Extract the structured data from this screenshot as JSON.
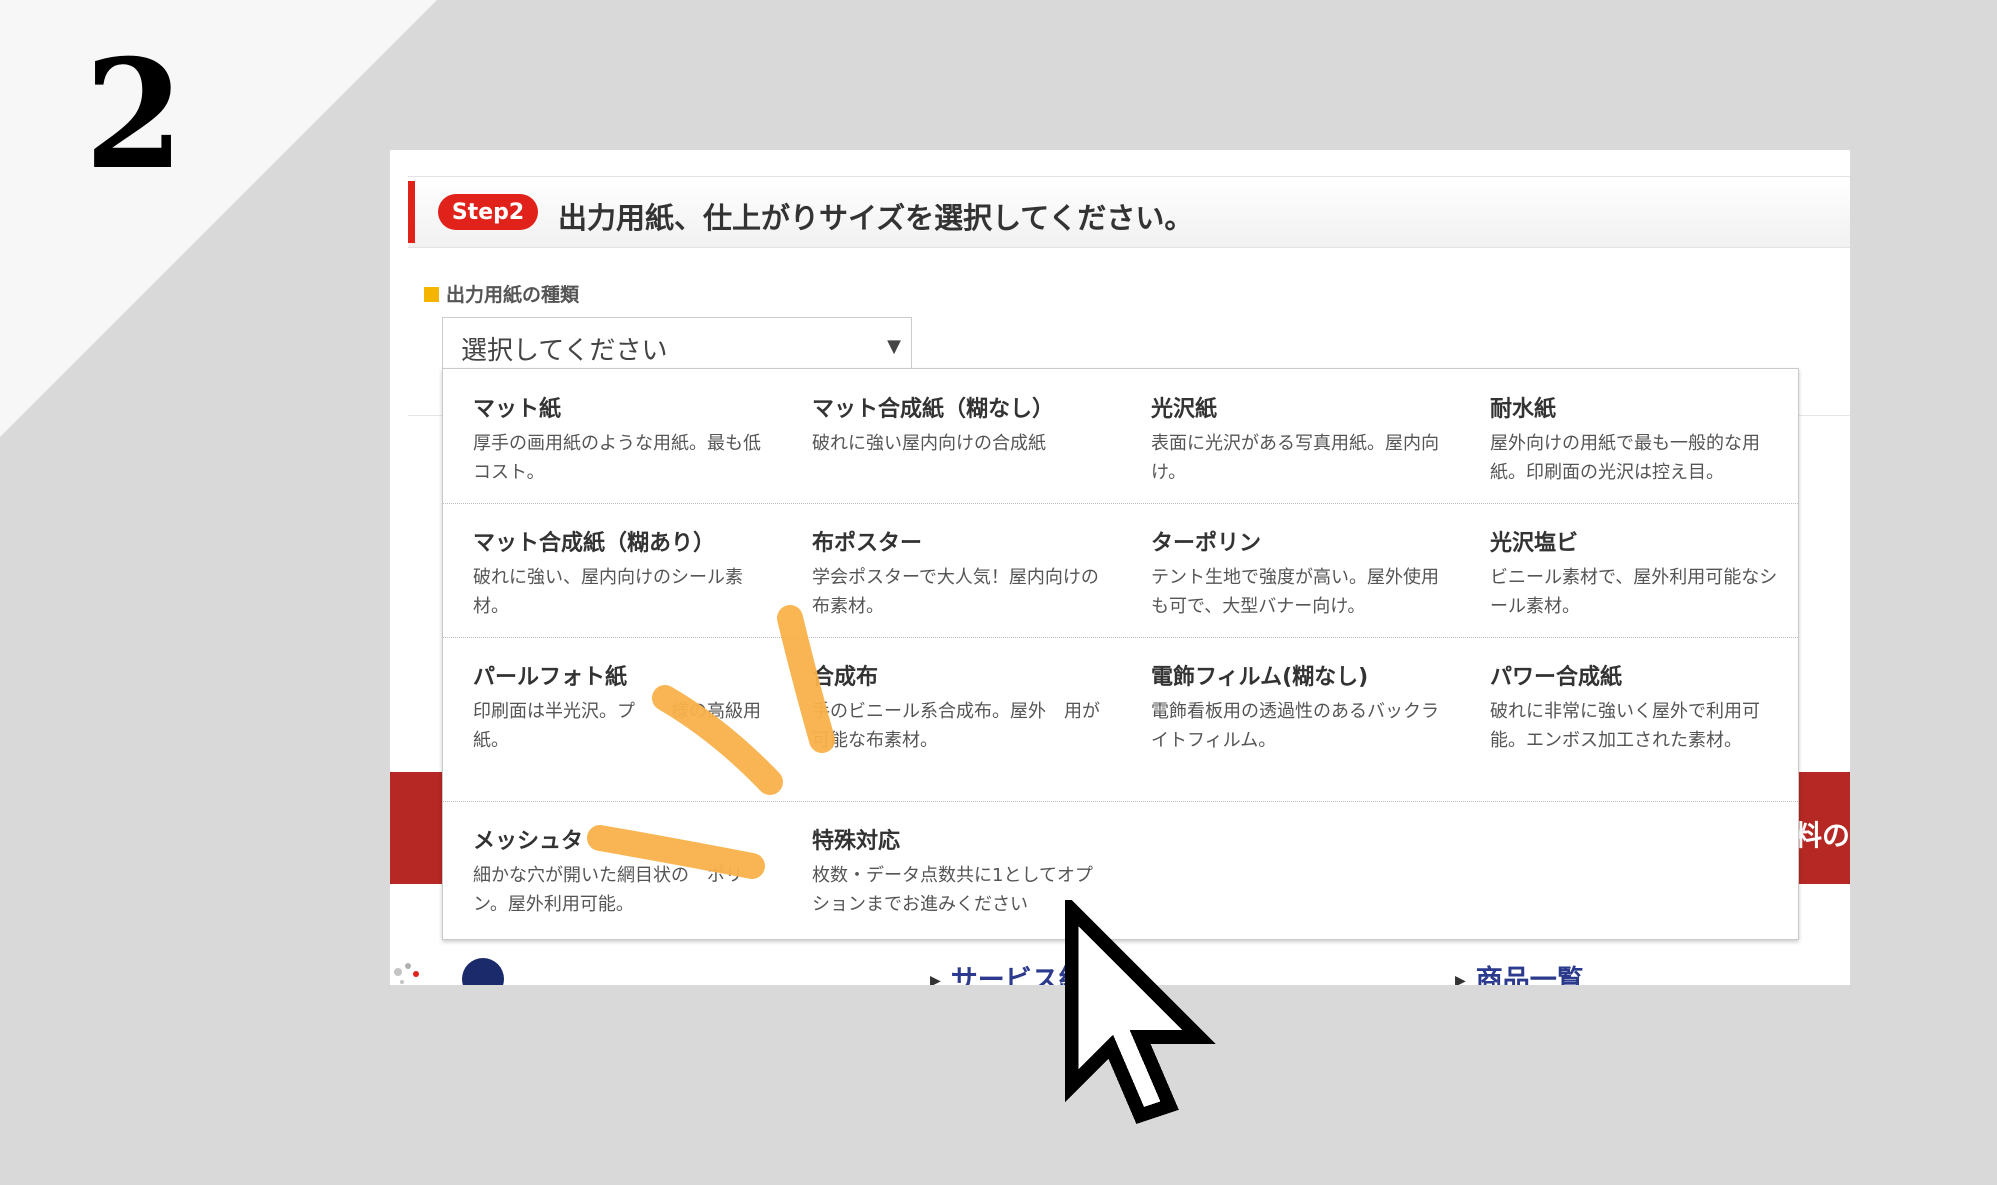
{
  "step_number": "2",
  "header": {
    "badge": "Step2",
    "title": "出力用紙、仕上がりサイズを選択してください。"
  },
  "paper_type": {
    "label": "出力用紙の種類",
    "select_value": "選択してください"
  },
  "options": [
    {
      "title": "マット紙",
      "desc": "厚手の画用紙のような用紙。最も低コスト。"
    },
    {
      "title": "マット合成紙（糊なし）",
      "desc": "破れに強い屋内向けの合成紙"
    },
    {
      "title": "光沢紙",
      "desc": "表面に光沢がある写真用紙。屋内向け。"
    },
    {
      "title": "耐水紙",
      "desc": "屋外向けの用紙で最も一般的な用紙。印刷面の光沢は控え目。"
    },
    {
      "title": "マット合成紙（糊あり）",
      "desc": "破れに強い、屋内向けのシール素材。"
    },
    {
      "title": "布ポスター",
      "desc": "学会ポスターで大人気！屋内向けの布素材。"
    },
    {
      "title": "ターポリン",
      "desc": "テント生地で強度が高い。屋外使用も可で、大型バナー向け。"
    },
    {
      "title": "光沢塩ビ",
      "desc": "ビニール素材で、屋外利用可能なシール素材。"
    },
    {
      "title": "パールフォト紙",
      "desc": "印刷面は半光沢。プ　　様の高級用紙。"
    },
    {
      "title": "合成布",
      "desc": "手のビニール系合成布。屋外　用が可能な布素材。"
    },
    {
      "title": "電飾フィルム(糊なし)",
      "desc": "電飾看板用の透過性のあるバックライトフィルム。"
    },
    {
      "title": "パワー合成紙",
      "desc": "破れに非常に強いく屋外で利用可能。エンボス加工された素材。"
    },
    {
      "title": "メッシュタ",
      "desc": "細かな穴が開いた網目状の　ポリン。屋外利用可能。"
    },
    {
      "title": "特殊対応",
      "desc": "枚数・データ点数共に1としてオプションまでお進みください"
    }
  ],
  "footer": {
    "link_service": "サービス紹",
    "link_products": "商品一覧",
    "band_text": "料の"
  },
  "colors": {
    "accent_red": "#e0221b",
    "band_red": "#b52824",
    "label_yellow": "#f5b400",
    "highlight_orange": "#f9b24a",
    "link_navy": "#2b3a8c"
  },
  "icons": {
    "cursor": "pointer-arrow-icon",
    "select_caret": "caret-down-icon"
  }
}
